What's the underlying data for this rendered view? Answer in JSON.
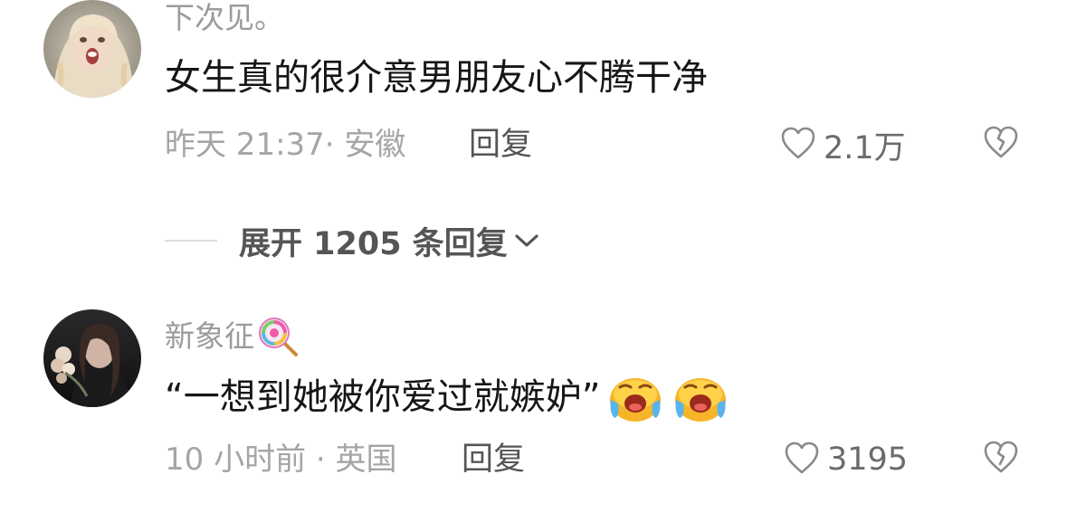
{
  "comments": [
    {
      "username": "下次见。",
      "text": "女生真的很介意男朋友心不腾干净",
      "time": "昨天 21:37",
      "location": "安徽",
      "reply_label": "回复",
      "likes": "2.1万"
    },
    {
      "username": "新象征",
      "text": "“一想到她被你爱过就嫉妒”",
      "time": "10 小时前",
      "location": "英国",
      "reply_label": "回复",
      "likes": "3195"
    }
  ],
  "expand_replies": {
    "label": "展开 1205 条回复"
  },
  "meta_separator": "·",
  "colors": {
    "text_primary": "#161616",
    "text_secondary": "#9b9b9b",
    "reply_button": "#555555",
    "divider": "#dcdcdc"
  },
  "icons": {
    "like": "heart-outline-icon",
    "dislike": "broken-heart-icon",
    "expand": "chevron-down-icon",
    "username_badge": "lollipop-icon",
    "emoji": "crying-face-emoji"
  }
}
